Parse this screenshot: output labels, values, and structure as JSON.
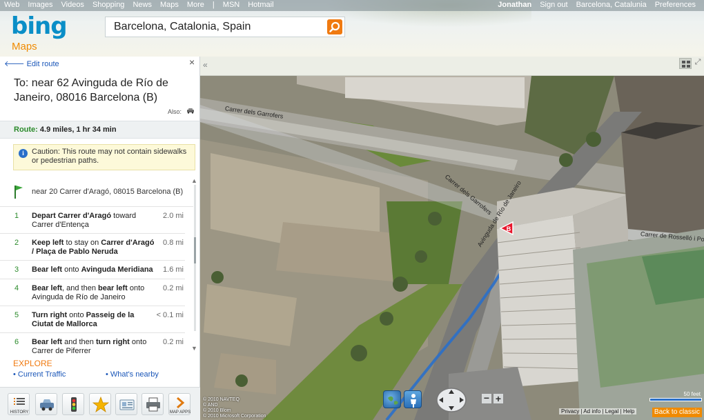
{
  "topnav": {
    "links": [
      "Web",
      "Images",
      "Videos",
      "Shopping",
      "News",
      "Maps",
      "More",
      "|",
      "MSN",
      "Hotmail"
    ],
    "user": "Jonathan",
    "signout": "Sign out",
    "location": "Barcelona, Catalunia",
    "preferences": "Preferences"
  },
  "brand": {
    "logo": "bing",
    "product": "Maps"
  },
  "search": {
    "value": "Barcelona, Catalonia, Spain",
    "icon": "search-icon"
  },
  "panel": {
    "edit_route": "Edit route",
    "close": "×",
    "destination": "To: near 62 Avinguda de Río de Janeiro, 08016 Barcelona (B)",
    "also": "Also:",
    "route_label": "Route:",
    "route_value": "4.9 miles,  1 hr 34 min",
    "caution": "Caution: This route may not contain sidewalks or pedestrian paths.",
    "start": "near 20 Carrer d'Aragó, 08015 Barcelona (B)",
    "steps": [
      {
        "num": "1",
        "b1": "Depart Carrer d'Aragó",
        "t1": " toward Carrer d'Entença",
        "b2": "",
        "t2": "",
        "dist": "2.0 mi"
      },
      {
        "num": "2",
        "b1": "Keep left",
        "t1": " to stay on ",
        "b2": "Carrer d'Aragó / Plaça de Pablo Neruda",
        "t2": "",
        "dist": "0.8 mi"
      },
      {
        "num": "3",
        "b1": "Bear left",
        "t1": " onto ",
        "b2": "Avinguda Meridiana",
        "t2": "",
        "dist": "1.6 mi"
      },
      {
        "num": "4",
        "b1": "Bear left",
        "t1": ", and then ",
        "b2": "bear left",
        "t2": " onto Avinguda de Río de Janeiro",
        "dist": "0.2 mi"
      },
      {
        "num": "5",
        "b1": "Turn right",
        "t1": " onto ",
        "b2": "Passeig de la Ciutat de Mallorca",
        "t2": "",
        "dist": "< 0.1 mi"
      },
      {
        "num": "6",
        "b1": "Bear left",
        "t1": " and then ",
        "b2": "turn right",
        "t2": " onto Carrer de Piferrer",
        "dist": "0.2 mi"
      }
    ],
    "explore": "EXPLORE",
    "link_traffic": "• Current Traffic",
    "link_nearby": "• What's nearby",
    "toolbar": [
      {
        "icon": "history-icon",
        "label": "HISTORY"
      },
      {
        "icon": "car-icon",
        "label": ""
      },
      {
        "icon": "traffic-light-icon",
        "label": ""
      },
      {
        "icon": "star-icon",
        "label": ""
      },
      {
        "icon": "card-icon",
        "label": ""
      },
      {
        "icon": "printer-icon",
        "label": ""
      },
      {
        "icon": "chevron-right-icon",
        "label": "MAP APPS"
      }
    ]
  },
  "map": {
    "labels": {
      "garrofers1": "Carrer dels Garrofers",
      "garrofers2": "Carrer dels Garrofers",
      "rio": "Avinguda de Río de Janeiro",
      "rossello": "Carrer de Rosselló i Porcel"
    },
    "marker": "B",
    "scale": "50 feet",
    "copyright_lines": [
      "© 2010 NAVTEQ",
      "© AND",
      "© 2010 Blom",
      "© 2010 Microsoft Corporation"
    ],
    "footer_links": "Privacy | Ad info | Legal | Help",
    "back_to_classic": "Back to classic",
    "zoom_out": "−",
    "zoom_in": "+"
  },
  "colors": {
    "brand_blue": "#0a8ec7",
    "accent_orange": "#f08a00",
    "link_blue": "#1a56b8",
    "step_green": "#2a8a2a"
  }
}
